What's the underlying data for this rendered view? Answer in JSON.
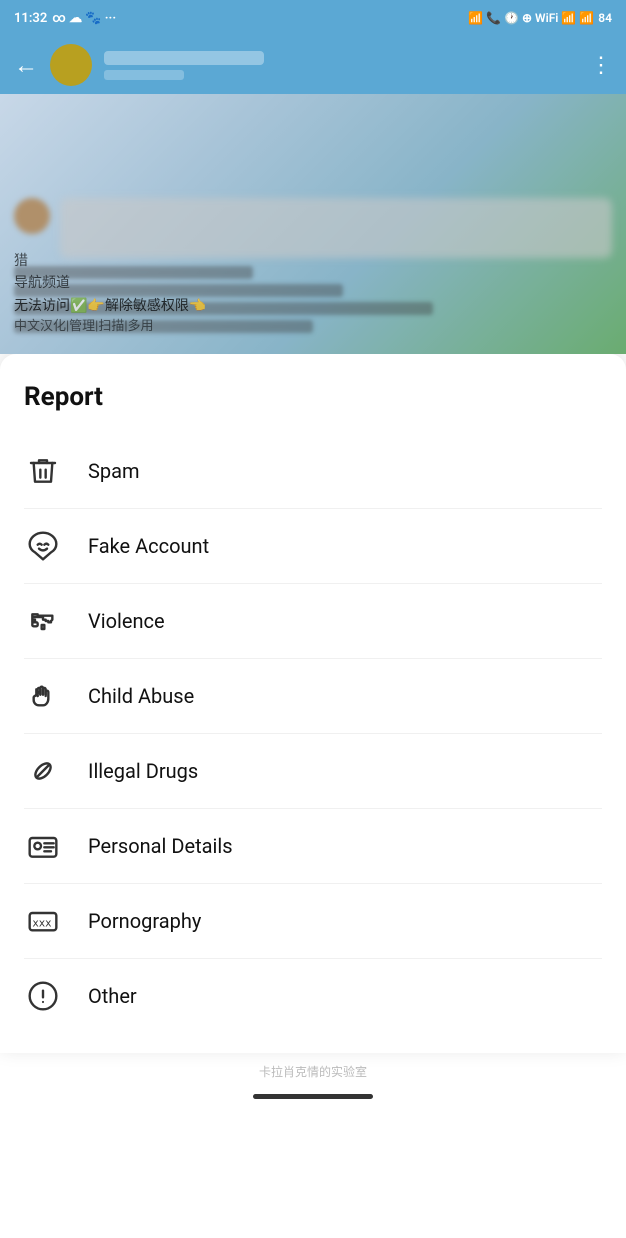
{
  "statusBar": {
    "time": "11:32",
    "carrier": "∞",
    "batteryLevel": "84"
  },
  "navBar": {
    "backLabel": "←",
    "moreLabel": "⋮"
  },
  "chatPreview": {
    "line1": "猎",
    "line2": "导航频道",
    "emojiLine": "无法访问✅👉解除敏感权限👈",
    "subLine": "中文汉化|管理|扫描|多用"
  },
  "report": {
    "title": "Report",
    "items": [
      {
        "id": "spam",
        "label": "Spam",
        "icon": "trash"
      },
      {
        "id": "fake-account",
        "label": "Fake Account",
        "icon": "mask"
      },
      {
        "id": "violence",
        "label": "Violence",
        "icon": "gun"
      },
      {
        "id": "child-abuse",
        "label": "Child Abuse",
        "icon": "hand"
      },
      {
        "id": "illegal-drugs",
        "label": "Illegal Drugs",
        "icon": "pill"
      },
      {
        "id": "personal-details",
        "label": "Personal Details",
        "icon": "id-card"
      },
      {
        "id": "pornography",
        "label": "Pornography",
        "icon": "xxx"
      },
      {
        "id": "other",
        "label": "Other",
        "icon": "exclamation"
      }
    ]
  },
  "watermark": "卡拉肖克情的实验室"
}
